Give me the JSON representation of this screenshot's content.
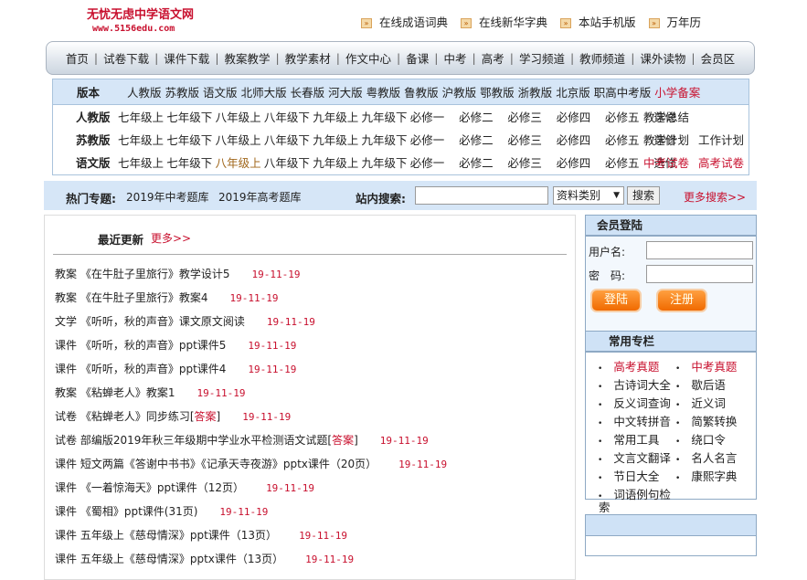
{
  "logo": {
    "title": "无忧无虑中学语文网",
    "url": "www.5156edu.com"
  },
  "top_links": [
    "在线成语词典",
    "在线新华字典",
    "本站手机版",
    "万年历"
  ],
  "nav": [
    "首页",
    "试卷下载",
    "课件下载",
    "教案教学",
    "教学素材",
    "作文中心",
    "备课",
    "中考",
    "高考",
    "学习频道",
    "教师频道",
    "课外读物",
    "会员区"
  ],
  "versions": {
    "label": "版本",
    "items": [
      "人教版",
      "苏教版",
      "语文版",
      "北师大版",
      "长春版",
      "河大版",
      "粤教版",
      "鲁教版",
      "沪教版",
      "鄂教版",
      "浙教版",
      "北京版",
      "职高中考版"
    ],
    "special": "小学备案"
  },
  "grade_rows": [
    {
      "label": "人教版",
      "extra": [
        "教学总结"
      ]
    },
    {
      "label": "苏教版",
      "extra": [
        "教学计划",
        "工作计划"
      ]
    },
    {
      "label": "语文版",
      "extra": [
        "中考试卷",
        "高考试卷"
      ]
    }
  ],
  "grades": [
    "七年级上",
    "七年级下",
    "八年级上",
    "八年级下",
    "九年级上",
    "九年级下",
    "必修一",
    "必修二",
    "必修三",
    "必修四",
    "必修五",
    "选修"
  ],
  "hot": {
    "label": "热门专题:",
    "links": [
      "2019年中考题库",
      "2019年高考题库"
    ],
    "search_label": "站内搜索:",
    "search_value": "",
    "category": "资料类别",
    "search_button": "搜索",
    "more": "更多搜索>>"
  },
  "recent": {
    "title": "最近更新",
    "more": "更多>>",
    "items": [
      {
        "cat": "教案",
        "title": "《在牛肚子里旅行》教学设计5",
        "answer": "",
        "date": "19-11-19"
      },
      {
        "cat": "教案",
        "title": "《在牛肚子里旅行》教案4",
        "answer": "",
        "date": "19-11-19"
      },
      {
        "cat": "文学",
        "title": "《听听，秋的声音》课文原文阅读",
        "answer": "",
        "date": "19-11-19"
      },
      {
        "cat": "课件",
        "title": "《听听，秋的声音》ppt课件5",
        "answer": "",
        "date": "19-11-19"
      },
      {
        "cat": "课件",
        "title": "《听听，秋的声音》ppt课件4",
        "answer": "",
        "date": "19-11-19"
      },
      {
        "cat": "教案",
        "title": "《粘蝉老人》教案1",
        "answer": "",
        "date": "19-11-19"
      },
      {
        "cat": "试卷",
        "title": "《粘蝉老人》同步练习[",
        "answer": "答案",
        "date": "19-11-19"
      },
      {
        "cat": "试卷",
        "title": "部编版2019年秋三年级期中学业水平检测语文试题[",
        "answer": "答案",
        "date": "19-11-19"
      },
      {
        "cat": "课件",
        "title": "短文两篇《答谢中书书》《记承天寺夜游》pptx课件（20页）",
        "answer": "",
        "date": "19-11-19"
      },
      {
        "cat": "课件",
        "title": "《一着惊海天》ppt课件（12页）",
        "answer": "",
        "date": "19-11-19"
      },
      {
        "cat": "课件",
        "title": "《蜀相》ppt课件(31页)",
        "answer": "",
        "date": "19-11-19"
      },
      {
        "cat": "课件",
        "title": "五年级上《慈母情深》ppt课件（13页）",
        "answer": "",
        "date": "19-11-19"
      },
      {
        "cat": "课件",
        "title": "五年级上《慈母情深》pptx课件（13页）",
        "answer": "",
        "date": "19-11-19"
      }
    ]
  },
  "login": {
    "title": "会员登陆",
    "username_label": "用户名:",
    "password_label": "密　码:",
    "username": "",
    "password": "",
    "login_button": "登陆",
    "register_button": "注册"
  },
  "columns": {
    "title": "常用专栏",
    "items": [
      "高考真题",
      "中考真题",
      "古诗词大全",
      "歇后语",
      "反义词查询",
      "近义词",
      "中文转拼音",
      "简繁转换",
      "常用工具",
      "绕口令",
      "文言文翻译",
      "名人名言",
      "节日大全",
      "康熙字典",
      "词语例句检"
    ],
    "overflow": "索"
  },
  "colors": {
    "red": "#c8102e",
    "blue_bg": "#d6e6f7"
  }
}
